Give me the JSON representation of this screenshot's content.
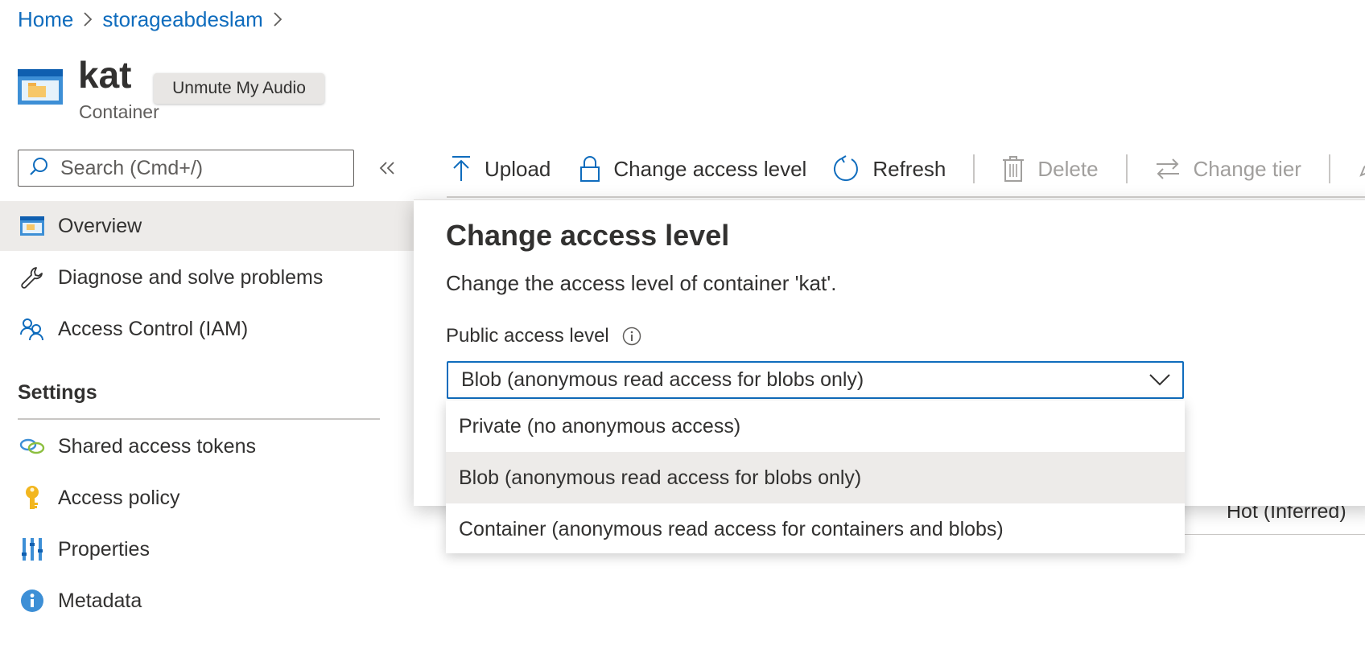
{
  "breadcrumb": {
    "items": [
      "Home",
      "storageabdeslam"
    ]
  },
  "header": {
    "title": "kat",
    "subtitle": "Container",
    "icon": "container-icon"
  },
  "tooltip": {
    "text": "Unmute My Audio"
  },
  "sidebar": {
    "search_placeholder": "Search (Cmd+/)",
    "items": [
      {
        "label": "Overview",
        "icon": "overview-icon",
        "active": true
      },
      {
        "label": "Diagnose and solve problems",
        "icon": "wrench-icon"
      },
      {
        "label": "Access Control (IAM)",
        "icon": "people-icon"
      }
    ],
    "settings_heading": "Settings",
    "settings_items": [
      {
        "label": "Shared access tokens",
        "icon": "link-icon"
      },
      {
        "label": "Access policy",
        "icon": "key-icon"
      },
      {
        "label": "Properties",
        "icon": "properties-icon"
      },
      {
        "label": "Metadata",
        "icon": "info-icon"
      }
    ]
  },
  "toolbar": {
    "upload": "Upload",
    "change_access_level": "Change access level",
    "refresh": "Refresh",
    "delete": "Delete",
    "change_tier": "Change tier"
  },
  "background": {
    "tier_text": "Hot (Inferred)"
  },
  "panel": {
    "title": "Change access level",
    "description": "Change the access level of container 'kat'.",
    "field_label": "Public access level",
    "selected_value": "Blob (anonymous read access for blobs only)",
    "options": [
      "Private (no anonymous access)",
      "Blob (anonymous read access for blobs only)",
      "Container (anonymous read access for containers and blobs)"
    ],
    "selected_index": 1
  },
  "colors": {
    "accent": "#0f6cbd",
    "text": "#323130",
    "muted": "#605e5c",
    "disabled": "#a19f9d",
    "selected_bg": "#edebe9"
  }
}
